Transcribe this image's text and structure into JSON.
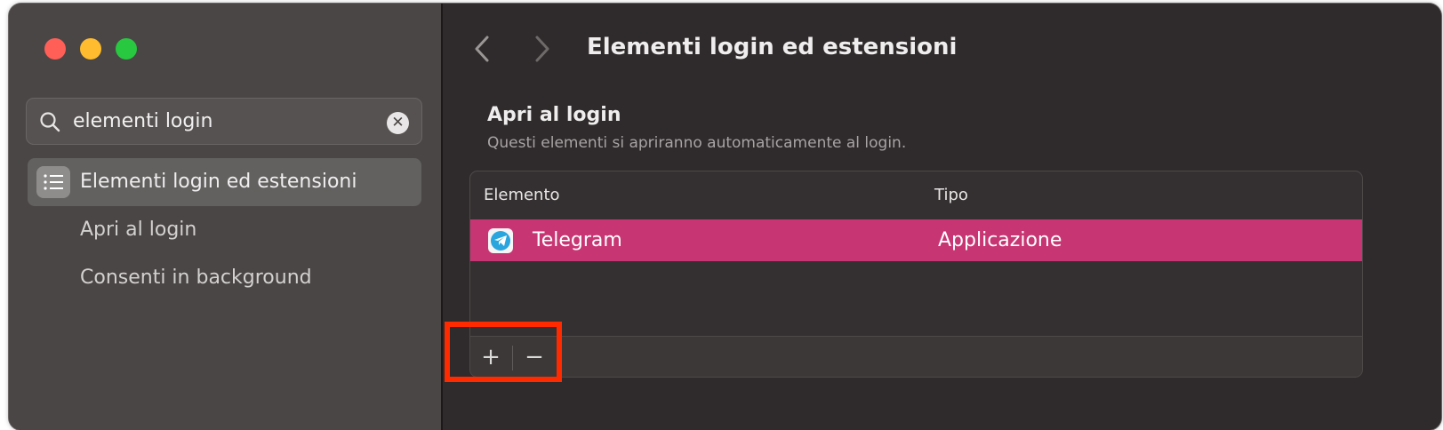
{
  "sidebar": {
    "search": {
      "value": "elementi login",
      "icon": "search-icon"
    },
    "items": [
      {
        "label": "Elementi login ed estensioni",
        "icon": "list-icon",
        "active": true
      },
      {
        "label": "Apri al login"
      },
      {
        "label": "Consenti in background"
      }
    ]
  },
  "header": {
    "title": "Elementi login ed estensioni"
  },
  "section": {
    "title": "Apri al login",
    "description": "Questi elementi si apriranno automaticamente al login."
  },
  "table": {
    "columns": [
      "Elemento",
      "Tipo"
    ],
    "rows": [
      {
        "name": "Telegram",
        "type": "Applicazione",
        "icon": "telegram-icon"
      }
    ]
  },
  "toolbar": {
    "add_label": "+",
    "remove_label": "−"
  },
  "colors": {
    "selection": "#c83573",
    "highlight": "#ff2a00"
  }
}
